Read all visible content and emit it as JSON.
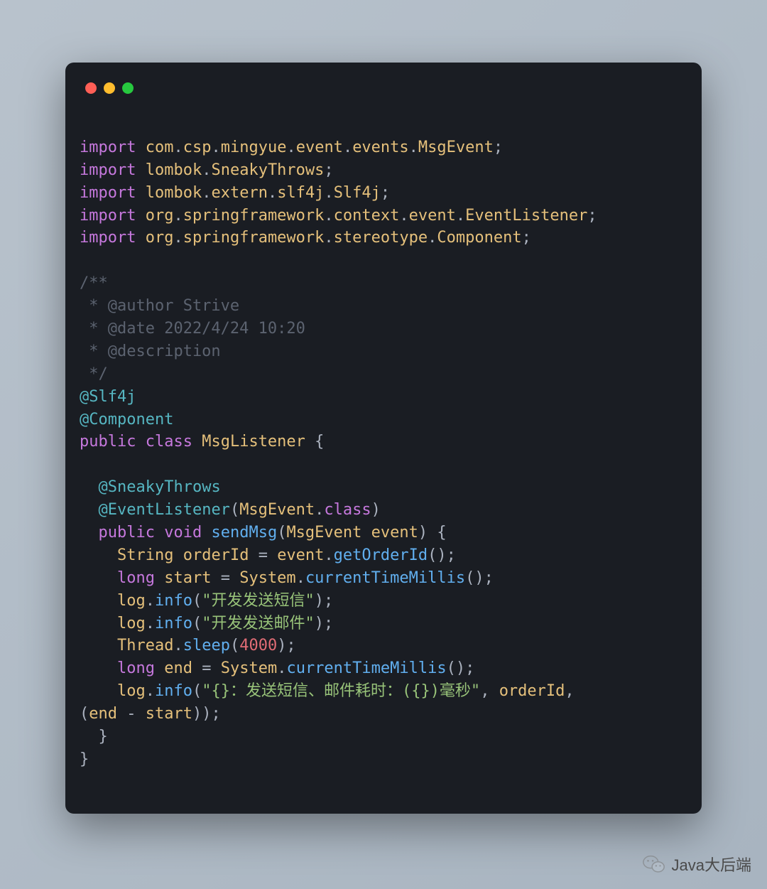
{
  "window": {
    "controls": [
      "close",
      "minimize",
      "zoom"
    ]
  },
  "code": {
    "lines": [
      [
        [
          "",
          ""
        ]
      ],
      [
        [
          "keyword",
          "import"
        ],
        [
          "plain",
          " "
        ],
        [
          "pkg",
          "com"
        ],
        [
          "op",
          "."
        ],
        [
          "pkg",
          "csp"
        ],
        [
          "op",
          "."
        ],
        [
          "pkg",
          "mingyue"
        ],
        [
          "op",
          "."
        ],
        [
          "pkg",
          "event"
        ],
        [
          "op",
          "."
        ],
        [
          "pkg",
          "events"
        ],
        [
          "op",
          "."
        ],
        [
          "pkg",
          "MsgEvent"
        ],
        [
          "op",
          ";"
        ]
      ],
      [
        [
          "keyword",
          "import"
        ],
        [
          "plain",
          " "
        ],
        [
          "pkg",
          "lombok"
        ],
        [
          "op",
          "."
        ],
        [
          "pkg",
          "SneakyThrows"
        ],
        [
          "op",
          ";"
        ]
      ],
      [
        [
          "keyword",
          "import"
        ],
        [
          "plain",
          " "
        ],
        [
          "pkg",
          "lombok"
        ],
        [
          "op",
          "."
        ],
        [
          "pkg",
          "extern"
        ],
        [
          "op",
          "."
        ],
        [
          "pkg",
          "slf4j"
        ],
        [
          "op",
          "."
        ],
        [
          "pkg",
          "Slf4j"
        ],
        [
          "op",
          ";"
        ]
      ],
      [
        [
          "keyword",
          "import"
        ],
        [
          "plain",
          " "
        ],
        [
          "pkg",
          "org"
        ],
        [
          "op",
          "."
        ],
        [
          "pkg",
          "springframework"
        ],
        [
          "op",
          "."
        ],
        [
          "pkg",
          "context"
        ],
        [
          "op",
          "."
        ],
        [
          "pkg",
          "event"
        ],
        [
          "op",
          "."
        ],
        [
          "pkg",
          "EventListener"
        ],
        [
          "op",
          ";"
        ]
      ],
      [
        [
          "keyword",
          "import"
        ],
        [
          "plain",
          " "
        ],
        [
          "pkg",
          "org"
        ],
        [
          "op",
          "."
        ],
        [
          "pkg",
          "springframework"
        ],
        [
          "op",
          "."
        ],
        [
          "pkg",
          "stereotype"
        ],
        [
          "op",
          "."
        ],
        [
          "pkg",
          "Component"
        ],
        [
          "op",
          ";"
        ]
      ],
      [
        [
          "",
          ""
        ]
      ],
      [
        [
          "comment",
          "/**"
        ]
      ],
      [
        [
          "comment",
          " * @author Strive"
        ]
      ],
      [
        [
          "comment",
          " * @date 2022/4/24 10:20"
        ]
      ],
      [
        [
          "comment",
          " * @description"
        ]
      ],
      [
        [
          "comment",
          " */"
        ]
      ],
      [
        [
          "annotation",
          "@Slf4j"
        ]
      ],
      [
        [
          "annotation",
          "@Component"
        ]
      ],
      [
        [
          "keyword",
          "public"
        ],
        [
          "plain",
          " "
        ],
        [
          "keyword",
          "class"
        ],
        [
          "plain",
          " "
        ],
        [
          "type",
          "MsgListener"
        ],
        [
          "plain",
          " "
        ],
        [
          "paren",
          "{"
        ]
      ],
      [
        [
          "",
          ""
        ]
      ],
      [
        [
          "plain",
          "  "
        ],
        [
          "annotation",
          "@SneakyThrows"
        ]
      ],
      [
        [
          "plain",
          "  "
        ],
        [
          "annotation",
          "@EventListener"
        ],
        [
          "paren",
          "("
        ],
        [
          "type",
          "MsgEvent"
        ],
        [
          "op",
          "."
        ],
        [
          "keyword",
          "class"
        ],
        [
          "paren",
          ")"
        ]
      ],
      [
        [
          "plain",
          "  "
        ],
        [
          "keyword",
          "public"
        ],
        [
          "plain",
          " "
        ],
        [
          "keyword",
          "void"
        ],
        [
          "plain",
          " "
        ],
        [
          "method",
          "sendMsg"
        ],
        [
          "paren",
          "("
        ],
        [
          "type",
          "MsgEvent"
        ],
        [
          "plain",
          " "
        ],
        [
          "var",
          "event"
        ],
        [
          "paren",
          ")"
        ],
        [
          "plain",
          " "
        ],
        [
          "paren",
          "{"
        ]
      ],
      [
        [
          "plain",
          "    "
        ],
        [
          "type",
          "String"
        ],
        [
          "plain",
          " "
        ],
        [
          "var",
          "orderId"
        ],
        [
          "plain",
          " "
        ],
        [
          "op",
          "="
        ],
        [
          "plain",
          " "
        ],
        [
          "var",
          "event"
        ],
        [
          "op",
          "."
        ],
        [
          "method",
          "getOrderId"
        ],
        [
          "paren",
          "();"
        ]
      ],
      [
        [
          "plain",
          "    "
        ],
        [
          "keyword",
          "long"
        ],
        [
          "plain",
          " "
        ],
        [
          "var",
          "start"
        ],
        [
          "plain",
          " "
        ],
        [
          "op",
          "="
        ],
        [
          "plain",
          " "
        ],
        [
          "type",
          "System"
        ],
        [
          "op",
          "."
        ],
        [
          "method",
          "currentTimeMillis"
        ],
        [
          "paren",
          "();"
        ]
      ],
      [
        [
          "plain",
          "    "
        ],
        [
          "var",
          "log"
        ],
        [
          "op",
          "."
        ],
        [
          "method",
          "info"
        ],
        [
          "paren",
          "("
        ],
        [
          "string",
          "\"开发发送短信\""
        ],
        [
          "paren",
          ");"
        ]
      ],
      [
        [
          "plain",
          "    "
        ],
        [
          "var",
          "log"
        ],
        [
          "op",
          "."
        ],
        [
          "method",
          "info"
        ],
        [
          "paren",
          "("
        ],
        [
          "string",
          "\"开发发送邮件\""
        ],
        [
          "paren",
          ");"
        ]
      ],
      [
        [
          "plain",
          "    "
        ],
        [
          "type",
          "Thread"
        ],
        [
          "op",
          "."
        ],
        [
          "method",
          "sleep"
        ],
        [
          "paren",
          "("
        ],
        [
          "number",
          "4000"
        ],
        [
          "paren",
          ");"
        ]
      ],
      [
        [
          "plain",
          "    "
        ],
        [
          "keyword",
          "long"
        ],
        [
          "plain",
          " "
        ],
        [
          "var",
          "end"
        ],
        [
          "plain",
          " "
        ],
        [
          "op",
          "="
        ],
        [
          "plain",
          " "
        ],
        [
          "type",
          "System"
        ],
        [
          "op",
          "."
        ],
        [
          "method",
          "currentTimeMillis"
        ],
        [
          "paren",
          "();"
        ]
      ],
      [
        [
          "plain",
          "    "
        ],
        [
          "var",
          "log"
        ],
        [
          "op",
          "."
        ],
        [
          "method",
          "info"
        ],
        [
          "paren",
          "("
        ],
        [
          "string",
          "\"{}：发送短信、邮件耗时：({})毫秒\""
        ],
        [
          "op",
          ","
        ],
        [
          "plain",
          " "
        ],
        [
          "var",
          "orderId"
        ],
        [
          "op",
          ","
        ],
        [
          "plain",
          " "
        ]
      ],
      [
        [
          "paren",
          "("
        ],
        [
          "var",
          "end"
        ],
        [
          "plain",
          " "
        ],
        [
          "op",
          "-"
        ],
        [
          "plain",
          " "
        ],
        [
          "var",
          "start"
        ],
        [
          "paren",
          "));"
        ]
      ],
      [
        [
          "plain",
          "  "
        ],
        [
          "paren",
          "}"
        ]
      ],
      [
        [
          "paren",
          "}"
        ]
      ]
    ]
  },
  "watermark": {
    "text": "Java大后端",
    "icon": "wechat"
  }
}
